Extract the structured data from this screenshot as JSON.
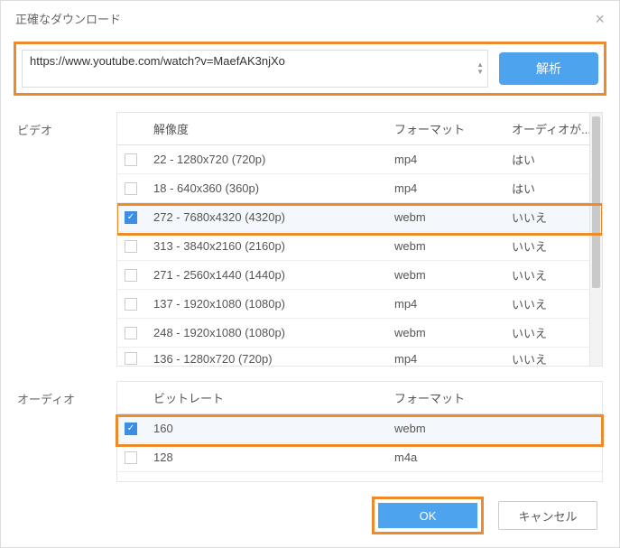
{
  "window": {
    "title": "正確なダウンロード"
  },
  "url": {
    "value": "https://www.youtube.com/watch?v=MaefAK3njXo"
  },
  "buttons": {
    "analyze": "解析",
    "ok": "OK",
    "cancel": "キャンセル"
  },
  "sections": {
    "video": "ビデオ",
    "audio": "オーディオ"
  },
  "video_headers": {
    "resolution": "解像度",
    "format": "フォーマット",
    "audio": "オーディオが..."
  },
  "video_rows": [
    {
      "res": "22 - 1280x720 (720p)",
      "fmt": "mp4",
      "aud": "はい",
      "checked": false
    },
    {
      "res": "18 - 640x360 (360p)",
      "fmt": "mp4",
      "aud": "はい",
      "checked": false
    },
    {
      "res": "272 - 7680x4320 (4320p)",
      "fmt": "webm",
      "aud": "いいえ",
      "checked": true
    },
    {
      "res": "313 - 3840x2160 (2160p)",
      "fmt": "webm",
      "aud": "いいえ",
      "checked": false
    },
    {
      "res": "271 - 2560x1440 (1440p)",
      "fmt": "webm",
      "aud": "いいえ",
      "checked": false
    },
    {
      "res": "137 - 1920x1080 (1080p)",
      "fmt": "mp4",
      "aud": "いいえ",
      "checked": false
    },
    {
      "res": "248 - 1920x1080 (1080p)",
      "fmt": "webm",
      "aud": "いいえ",
      "checked": false
    },
    {
      "res": "136 - 1280x720 (720p)",
      "fmt": "mp4",
      "aud": "いいえ",
      "checked": false
    }
  ],
  "audio_headers": {
    "bitrate": "ビットレート",
    "format": "フォーマット"
  },
  "audio_rows": [
    {
      "br": "160",
      "fmt": "webm",
      "checked": true
    },
    {
      "br": "128",
      "fmt": "m4a",
      "checked": false
    }
  ]
}
